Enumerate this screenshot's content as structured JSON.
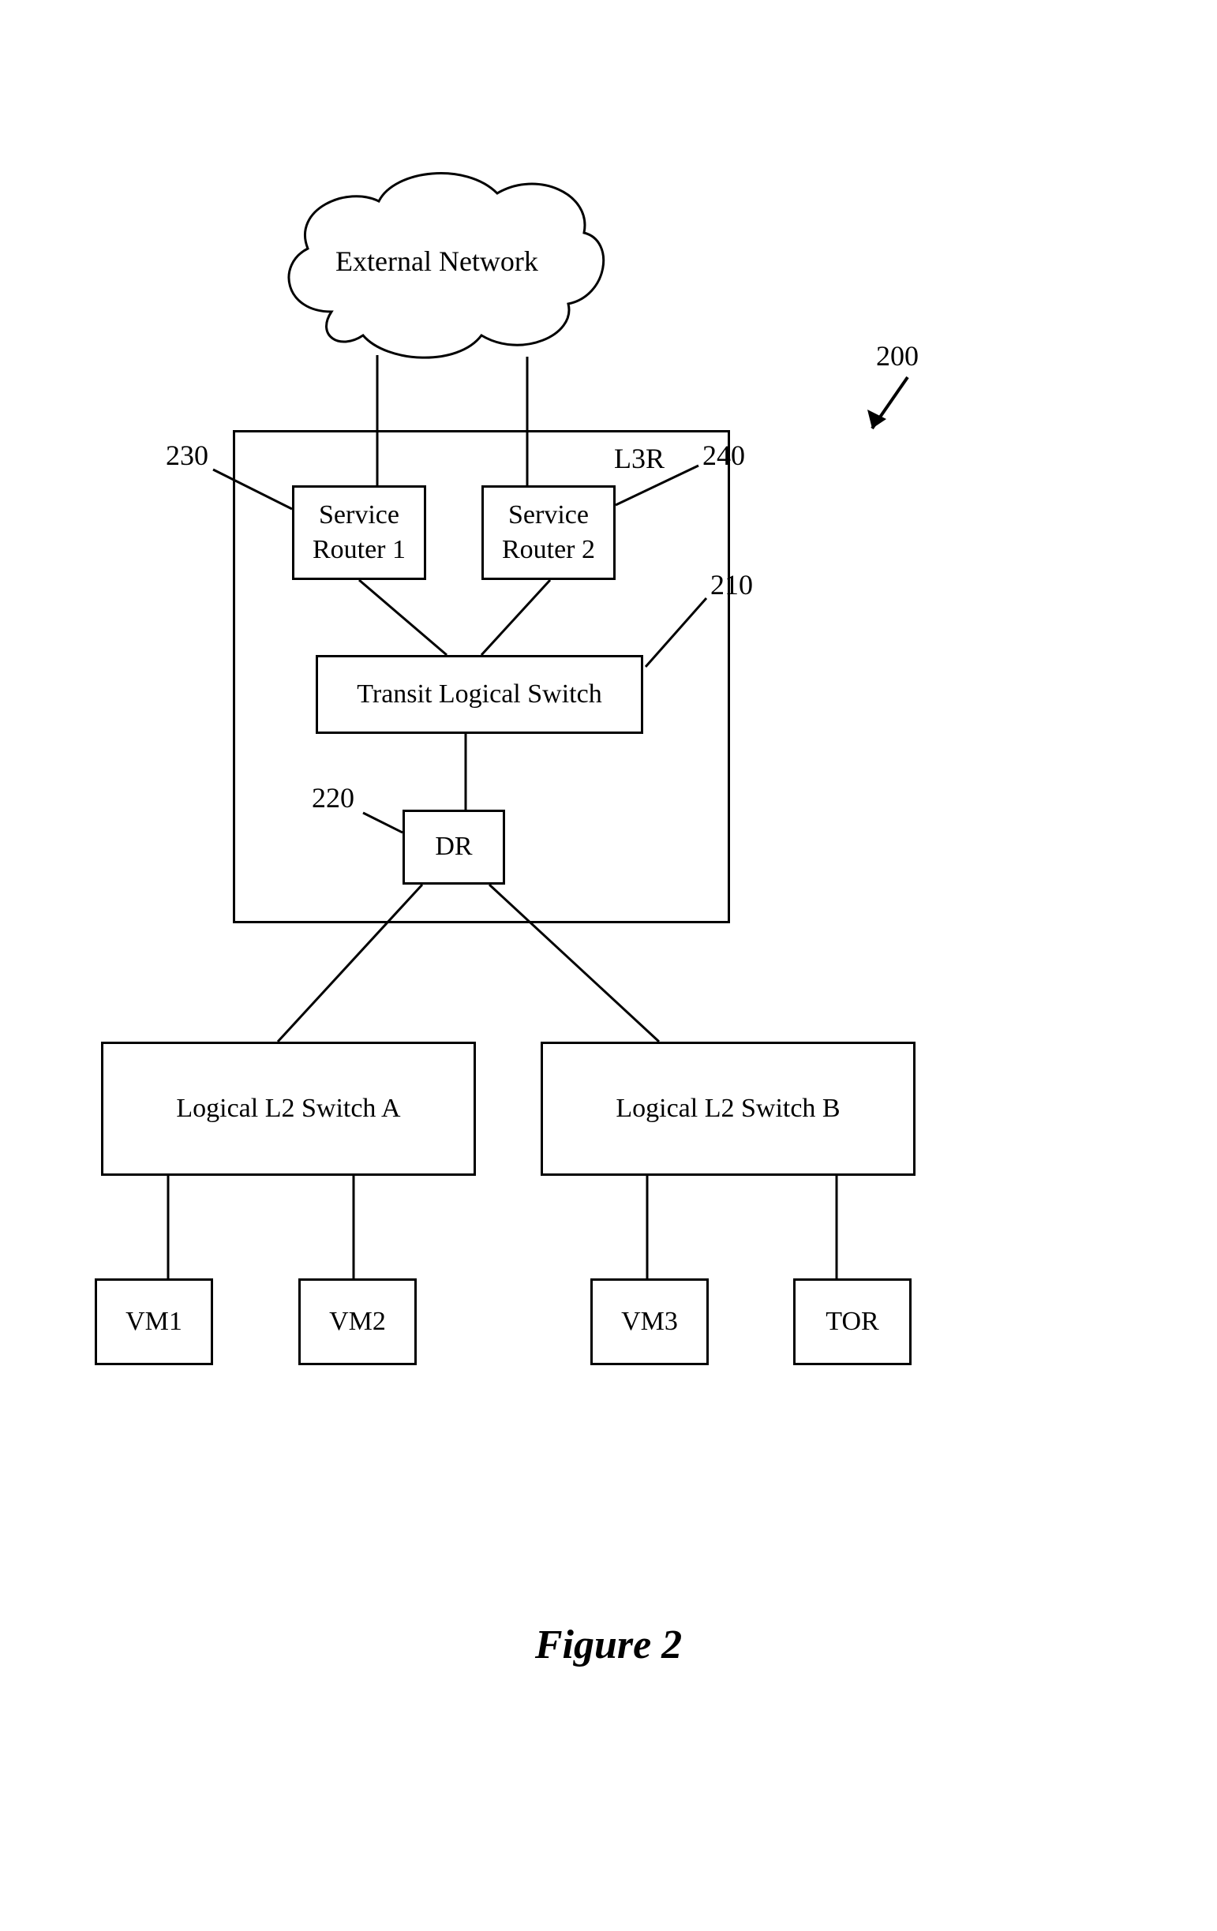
{
  "cloud": {
    "label": "External Network"
  },
  "l3r": {
    "label": "L3R",
    "sr1": "Service\nRouter 1",
    "sr2": "Service\nRouter 2",
    "tls": "Transit Logical Switch",
    "dr": "DR"
  },
  "switches": {
    "a": "Logical L2 Switch A",
    "b": "Logical L2 Switch B"
  },
  "endpoints": {
    "vm1": "VM1",
    "vm2": "VM2",
    "vm3": "VM3",
    "tor": "TOR"
  },
  "refs": {
    "r200": "200",
    "r210": "210",
    "r220": "220",
    "r230": "230",
    "r240": "240"
  },
  "figure": "Figure 2"
}
